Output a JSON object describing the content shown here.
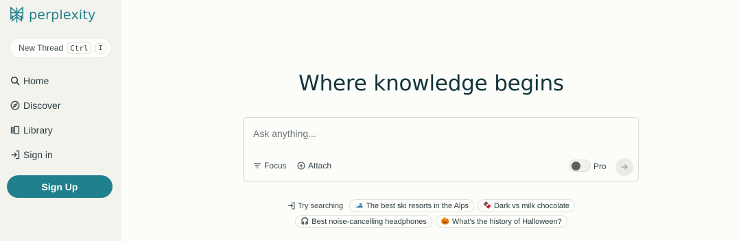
{
  "brand": {
    "name": "perplexity",
    "accent": "#20808d"
  },
  "sidebar": {
    "new_thread": {
      "label": "New Thread",
      "kbd_1": "Ctrl",
      "kbd_2": "I"
    },
    "items": [
      {
        "label": "Home",
        "icon": "search-icon"
      },
      {
        "label": "Discover",
        "icon": "compass-icon"
      },
      {
        "label": "Library",
        "icon": "library-icon"
      },
      {
        "label": "Sign in",
        "icon": "sign-in-icon"
      }
    ],
    "signup_label": "Sign Up"
  },
  "main": {
    "headline": "Where knowledge begins",
    "search": {
      "placeholder": "Ask anything...",
      "focus_label": "Focus",
      "attach_label": "Attach",
      "pro_label": "Pro",
      "pro_enabled": false
    },
    "suggestions": {
      "try_label": "Try searching",
      "chips": [
        {
          "label": "The best ski resorts in the Alps",
          "icon": "ski-icon"
        },
        {
          "label": "Dark vs milk chocolate",
          "icon": "chocolate-icon"
        },
        {
          "label": "Best noise-cancelling headphones",
          "icon": "headphones-icon"
        },
        {
          "label": "What's the history of Halloween?",
          "icon": "pumpkin-icon"
        }
      ]
    }
  }
}
